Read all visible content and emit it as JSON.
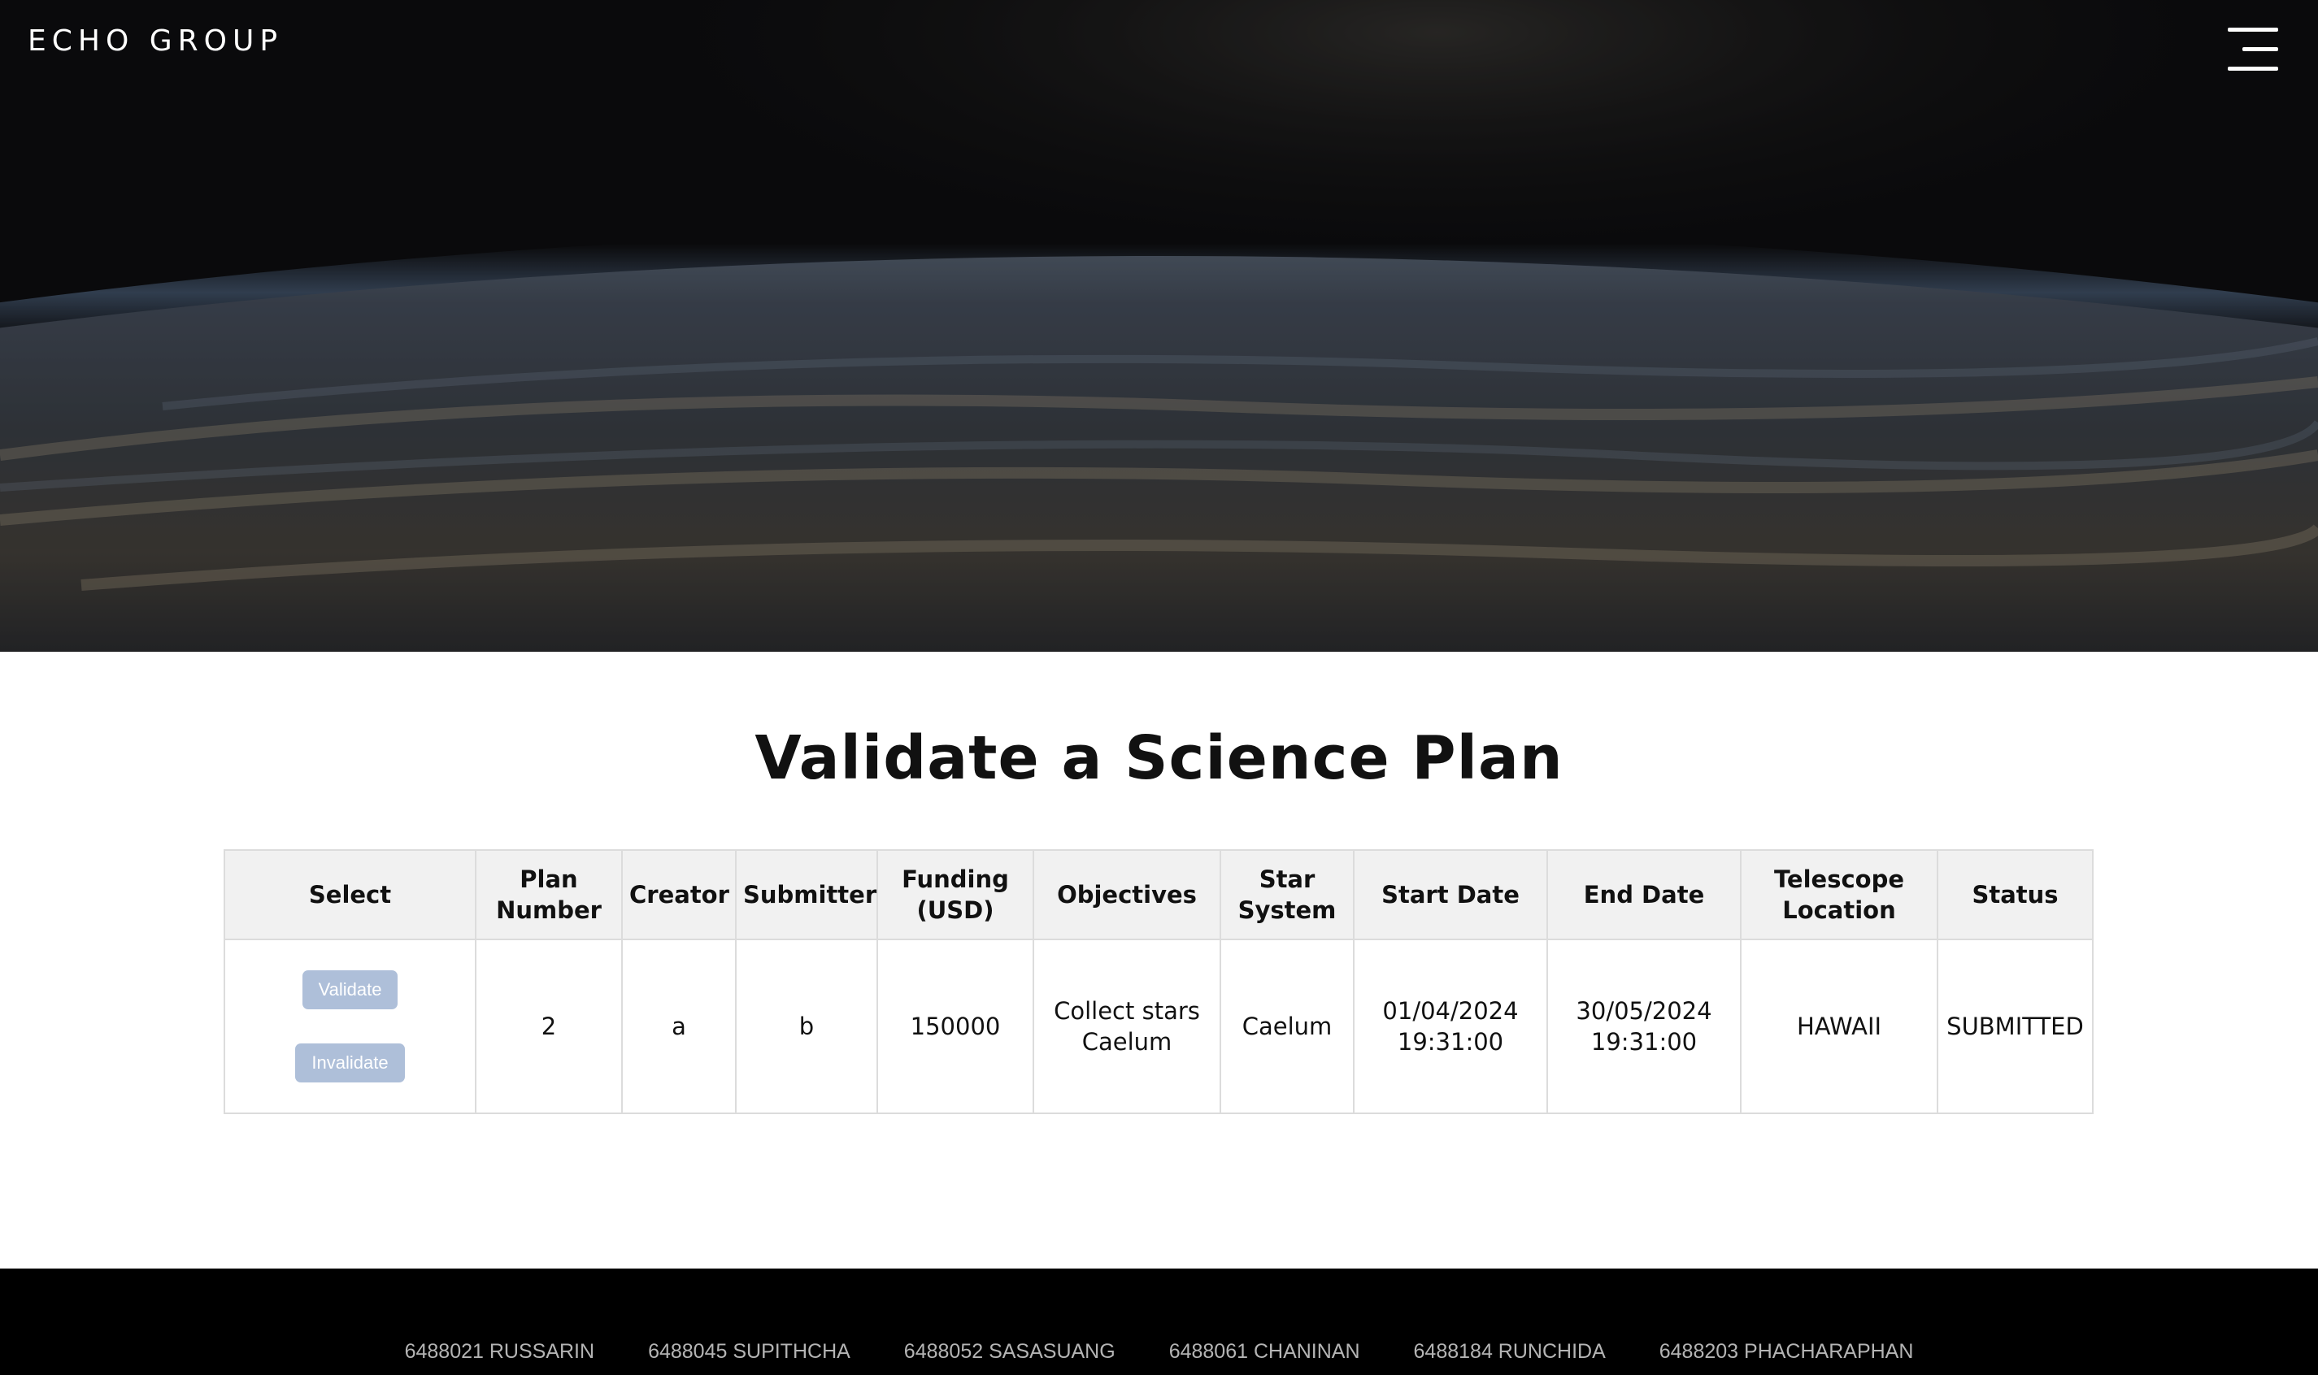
{
  "header": {
    "brand": "ECHO GROUP",
    "menu_icon": "hamburger-menu-icon"
  },
  "main": {
    "title": "Validate a Science Plan"
  },
  "table": {
    "columns": [
      "Select",
      "Plan Number",
      "Creator",
      "Submitter",
      "Funding (USD)",
      "Objectives",
      "Star System",
      "Start Date",
      "End Date",
      "Telescope Location",
      "Status"
    ],
    "rows": [
      {
        "validate_label": "Validate",
        "invalidate_label": "Invalidate",
        "plan_number": "2",
        "creator": "a",
        "submitter": "b",
        "funding": "150000",
        "objectives": "Collect stars Caelum",
        "star_system": "Caelum",
        "start_date": "01/04/2024 19:31:00",
        "end_date": "30/05/2024 19:31:00",
        "telescope_location": "HAWAII",
        "status": "SUBMITTED"
      }
    ]
  },
  "footer": {
    "members": [
      "6488021 RUSSARIN",
      "6488045 SUPITHCHA",
      "6488052 SASASUANG",
      "6488061 CHANINAN",
      "6488184 RUNCHIDA",
      "6488203 PHACHARAPHAN"
    ]
  },
  "colors": {
    "button_bg": "#aebfd9",
    "header_row_bg": "#f1f1f1",
    "footer_bg": "#000000"
  }
}
